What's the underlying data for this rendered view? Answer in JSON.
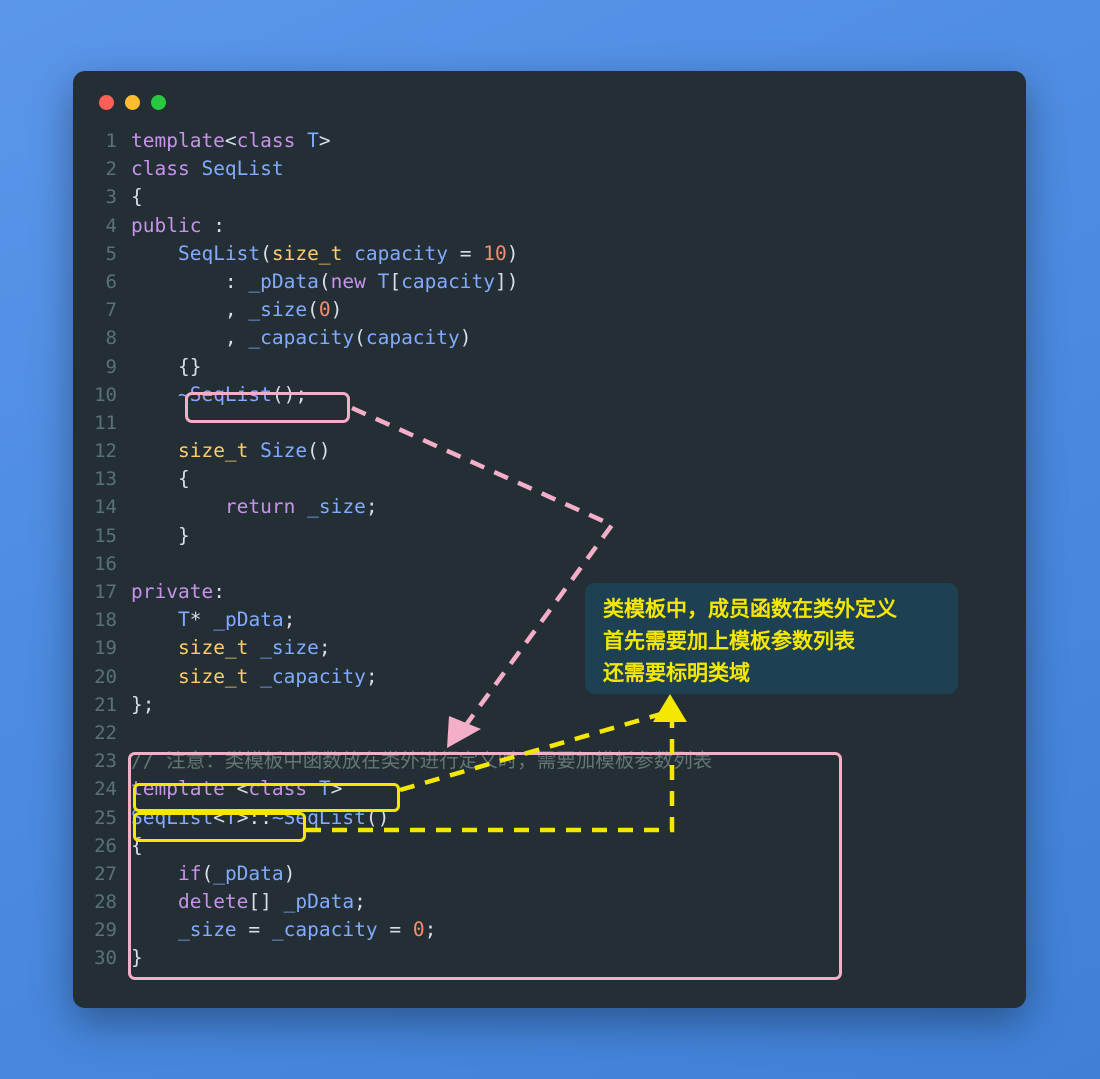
{
  "window": {
    "title_buttons": [
      {
        "name": "close",
        "color": "#ff5f57"
      },
      {
        "name": "minimize",
        "color": "#febc2e"
      },
      {
        "name": "maximize",
        "color": "#28c840"
      }
    ]
  },
  "theme": {
    "wallpaper": "#4a8ade",
    "editor_bg": "#232f34",
    "gutter_fg": "#5b7179",
    "keyword": "#c792ea",
    "type": "#ffcb6b",
    "identifier": "#82aaff",
    "number": "#f78c6c",
    "plain": "#d6deeb",
    "comment": "#637777",
    "pink_accent": "#f4aec8",
    "yellow_accent": "#f5e800",
    "tooltip_bg": "#1d4052"
  },
  "code": {
    "language": "C++",
    "lines": [
      {
        "n": "1",
        "text": "template<class T>"
      },
      {
        "n": "2",
        "text": "class SeqList"
      },
      {
        "n": "3",
        "text": "{"
      },
      {
        "n": "4",
        "text": "public :"
      },
      {
        "n": "5",
        "text": "    SeqList(size_t capacity = 10)"
      },
      {
        "n": "6",
        "text": "        : _pData(new T[capacity])"
      },
      {
        "n": "7",
        "text": "        , _size(0)"
      },
      {
        "n": "8",
        "text": "        , _capacity(capacity)"
      },
      {
        "n": "9",
        "text": "    {}"
      },
      {
        "n": "10",
        "text": "    ~SeqList();"
      },
      {
        "n": "11",
        "text": ""
      },
      {
        "n": "12",
        "text": "    size_t Size()"
      },
      {
        "n": "13",
        "text": "    {"
      },
      {
        "n": "14",
        "text": "        return _size;"
      },
      {
        "n": "15",
        "text": "    }"
      },
      {
        "n": "16",
        "text": ""
      },
      {
        "n": "17",
        "text": "private:"
      },
      {
        "n": "18",
        "text": "    T* _pData;"
      },
      {
        "n": "19",
        "text": "    size_t _size;"
      },
      {
        "n": "20",
        "text": "    size_t _capacity;"
      },
      {
        "n": "21",
        "text": "};"
      },
      {
        "n": "22",
        "text": ""
      },
      {
        "n": "23",
        "text": "// 注意：类模板中函数放在类外进行定义时，需要加模板参数列表"
      },
      {
        "n": "24",
        "text": "template <class T>"
      },
      {
        "n": "25",
        "text": "SeqList<T>::~SeqList()"
      },
      {
        "n": "26",
        "text": "{"
      },
      {
        "n": "27",
        "text": "    if(_pData)"
      },
      {
        "n": "28",
        "text": "    delete[] _pData;"
      },
      {
        "n": "29",
        "text": "    _size = _capacity = 0;"
      },
      {
        "n": "30",
        "text": "}"
      }
    ]
  },
  "annotations": {
    "tooltip": {
      "line1": "类模板中，成员函数在类外定义",
      "line2": "首先需要加上模板参数列表",
      "line3": "还需要标明类域"
    },
    "highlight_declaration": "~SeqList();",
    "highlight_template_param": "template <class T>",
    "highlight_class_scope": "SeqList<T>::",
    "highlight_block": "out-of-class destructor definition"
  }
}
